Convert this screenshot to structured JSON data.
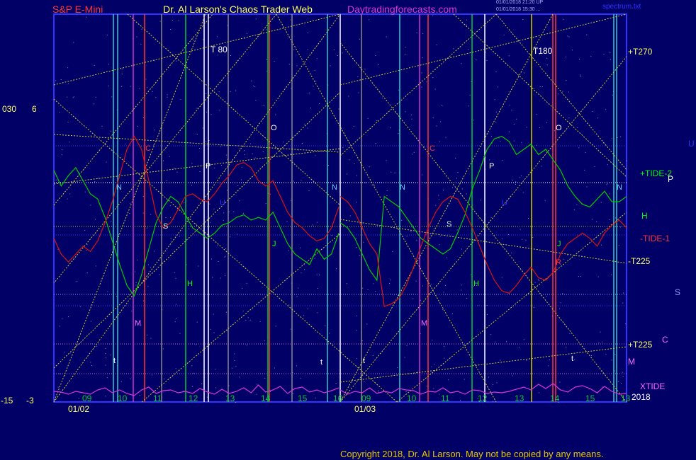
{
  "header": {
    "instrument": "S&P E-Mini",
    "site": "Dr. Al Larson's Chaos Trader Web",
    "url": "Daytradingforecasts.com",
    "stamp1": "01/01/2018 21:20 UP",
    "stamp2": "01/01/2018 15:30 ...",
    "file": "spectrum.txt"
  },
  "copyright": "Copyright 2018, Dr. Al Larson. May not be copied by any means.",
  "colors": {
    "background": "#000066",
    "frame": "#3333ff",
    "tide_plus2": "#00cc00",
    "tide_minus1": "#dd1111",
    "xtide": "#dd33dd",
    "grid_yellow": "#cccc33",
    "vline_cyan": "#33cccc",
    "vline_green": "#00cc33",
    "vline_magenta": "#cc33cc",
    "vline_red": "#ff3333",
    "vline_white": "#ffffff",
    "vline_yellow": "#cccc00"
  },
  "chart_data": {
    "type": "line",
    "title": "S&P E-Mini",
    "dates": [
      "01/02",
      "01/03"
    ],
    "x_ticks": [
      "09",
      "10",
      "11",
      "12",
      "13",
      "14",
      "15",
      "16",
      "09",
      "10",
      "11",
      "12",
      "13",
      "14",
      "15",
      "13"
    ],
    "left_axis": {
      "upper_labels": [
        "030",
        "6"
      ],
      "lower_labels": [
        "-15",
        "-3"
      ]
    },
    "year_label": "2018",
    "right_labels": [
      "+T270",
      "+TIDE-2",
      "H",
      "-TIDE-1",
      "-T225",
      "+T225",
      "M",
      "XTIDE"
    ],
    "far_right_labels": [
      "U",
      "P",
      "S",
      "C"
    ],
    "top_labels": [
      "T 80",
      "T180"
    ],
    "markers": [
      "C",
      "P",
      "O",
      "N",
      "S",
      "H",
      "J",
      "M",
      "R",
      "U",
      "L",
      "t"
    ],
    "ylim": [
      0,
      100
    ],
    "series": [
      {
        "name": "+TIDE-2",
        "color": "#00cc00",
        "values": [
          62,
          56,
          60,
          63,
          58,
          53,
          51,
          44,
          35,
          26,
          18,
          14,
          22,
          32,
          42,
          48,
          52,
          50,
          45,
          40,
          38,
          36,
          38,
          41,
          42,
          44,
          45,
          43,
          44,
          43,
          46,
          40,
          34,
          30,
          28,
          26,
          32,
          28,
          30,
          38,
          42,
          40,
          36,
          30,
          24,
          20,
          52,
          50,
          48,
          44,
          40,
          36,
          34,
          32,
          30,
          32,
          38,
          45,
          55,
          62,
          70,
          74,
          75,
          73,
          68,
          70,
          72,
          68,
          70,
          66,
          62,
          56,
          52,
          49,
          48,
          51,
          54,
          50,
          50,
          52
        ]
      },
      {
        "name": "-TIDE-1",
        "color": "#dd1111",
        "values": [
          36,
          30,
          27,
          30,
          33,
          31,
          35,
          42,
          50,
          60,
          70,
          75,
          70,
          58,
          45,
          40,
          42,
          47,
          52,
          53,
          51,
          50,
          53,
          57,
          60,
          64,
          65,
          63,
          58,
          56,
          58,
          52,
          46,
          42,
          40,
          37,
          35,
          36,
          40,
          48,
          52,
          50,
          46,
          40,
          34,
          30,
          10,
          11,
          13,
          18,
          25,
          33,
          40,
          46,
          50,
          52,
          51,
          46,
          40,
          33,
          26,
          20,
          16,
          15,
          18,
          22,
          25,
          21,
          20,
          23,
          30,
          34,
          36,
          38,
          36,
          33,
          38,
          41,
          43,
          40
        ]
      },
      {
        "name": "XTIDE",
        "color": "#dd33dd",
        "values": [
          7,
          6,
          3,
          7,
          5,
          3,
          9,
          12,
          5,
          9,
          4,
          1,
          9,
          13,
          4,
          8,
          9,
          5,
          7,
          4,
          11,
          6,
          3,
          10,
          4,
          7,
          12,
          5,
          16,
          6,
          9,
          14,
          4,
          11,
          13,
          6,
          9,
          5,
          8,
          12,
          9,
          3,
          7,
          5,
          12,
          4,
          7,
          5,
          11,
          9,
          8,
          3,
          7,
          6,
          12,
          5,
          7,
          3,
          9,
          8,
          4,
          6,
          5,
          7,
          10,
          13,
          9,
          17,
          11,
          18,
          9,
          6,
          13,
          15,
          11,
          5,
          14,
          7,
          3,
          4
        ]
      }
    ]
  }
}
